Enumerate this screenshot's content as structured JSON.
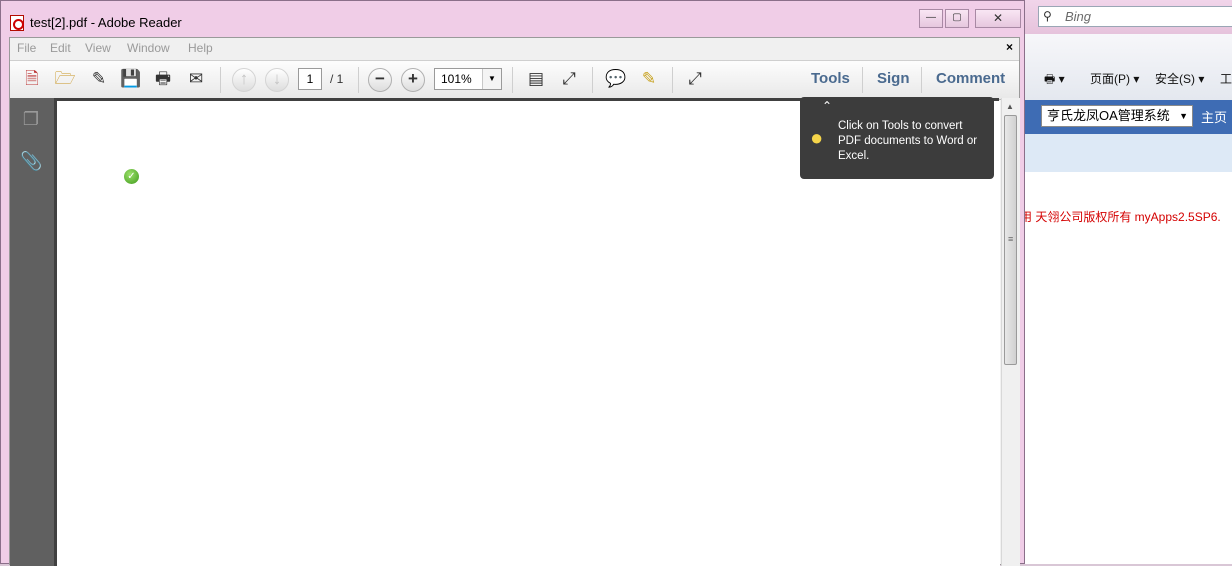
{
  "reader": {
    "title": "test[2].pdf - Adobe Reader",
    "caption": {
      "minimize": "—",
      "restore": "▢",
      "close": "✕"
    },
    "menu": [
      "File",
      "Edit",
      "View",
      "Window",
      "Help"
    ],
    "menu_close": "×",
    "toolbar": {
      "page_current": "1",
      "page_total": "/ 1",
      "zoom": "101%",
      "tools_label": "Tools",
      "sign_label": "Sign",
      "comment_label": "Comment"
    },
    "tooltip": {
      "text": "Click on Tools to convert PDF documents to Word or Excel."
    }
  },
  "ie": {
    "search_placeholder": "Bing",
    "cmd": {
      "print": "🖶 ▾",
      "page": "页面(P) ▾",
      "safety": "安全(S) ▾",
      "tools_partial": "工"
    },
    "system_select": "亨氏龙凤OA管理系统",
    "home": "主页",
    "footer_text": "用  天翎公司版权所有  myApps2.5SP6."
  }
}
